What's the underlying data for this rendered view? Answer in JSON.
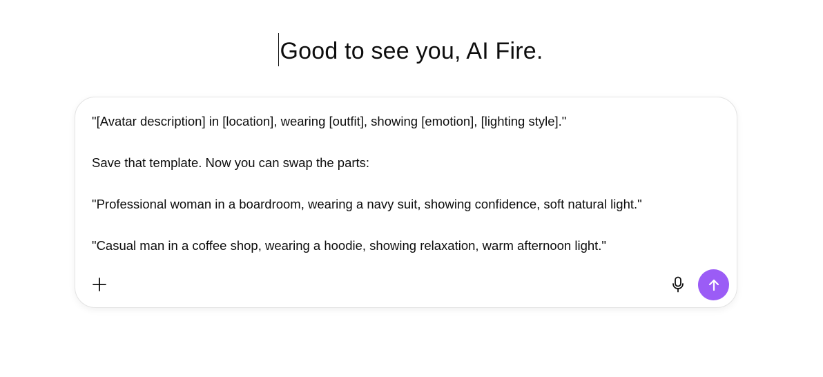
{
  "greeting": "Good to see you, AI Fire.",
  "composer": {
    "lines": [
      "\"[Avatar description] in [location], wearing [outfit], showing [emotion], [lighting style].\"",
      "Save that template. Now you can swap the parts:",
      "\"Professional woman in a boardroom, wearing a navy suit, showing confidence, soft natural light.\"",
      "\"Casual man in a coffee shop, wearing a hoodie, showing relaxation, warm afternoon light.\""
    ],
    "icons": {
      "add": "plus-icon",
      "voice": "microphone-icon",
      "send": "arrow-up-icon"
    },
    "send_button_color": "#9b5cf6"
  }
}
